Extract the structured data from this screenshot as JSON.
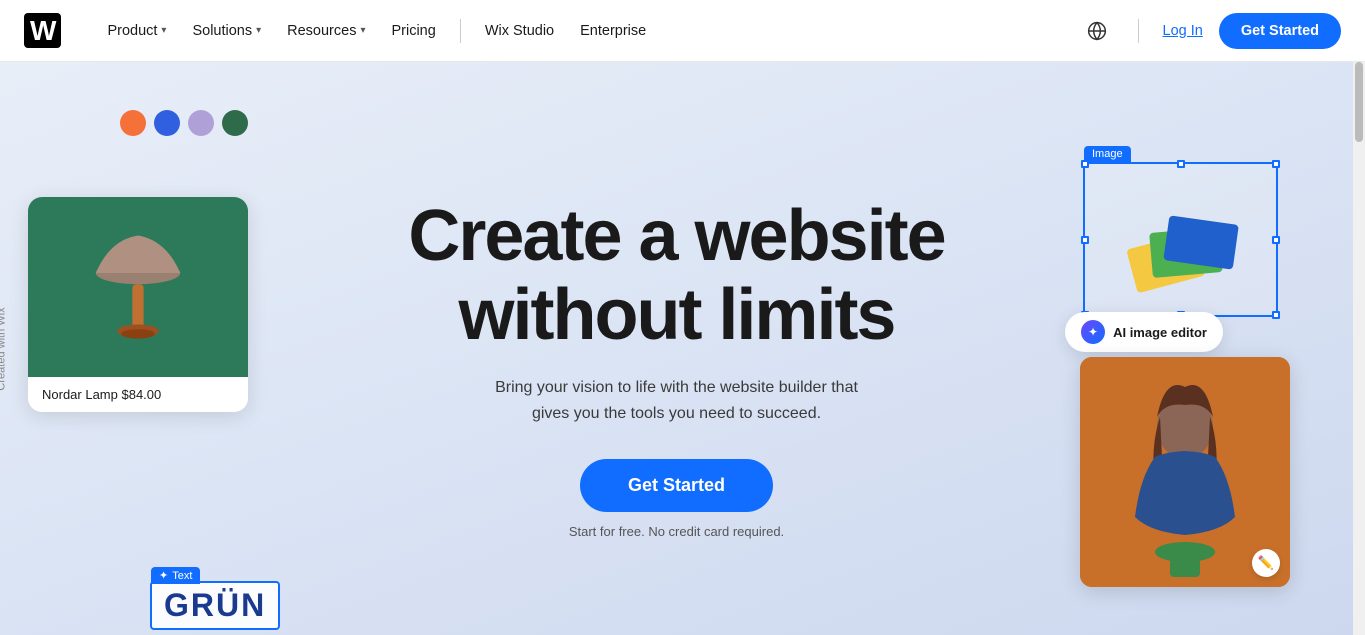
{
  "navbar": {
    "logo": "Wix",
    "nav_items": [
      {
        "label": "Product",
        "has_dropdown": true
      },
      {
        "label": "Solutions",
        "has_dropdown": true
      },
      {
        "label": "Resources",
        "has_dropdown": true
      },
      {
        "label": "Pricing",
        "has_dropdown": false
      },
      {
        "label": "Wix Studio",
        "has_dropdown": false
      },
      {
        "label": "Enterprise",
        "has_dropdown": false
      }
    ],
    "login_label": "Log In",
    "get_started_label": "Get Started"
  },
  "hero": {
    "title_line1": "Create a website",
    "title_line2": "without limits",
    "subtitle": "Bring your vision to life with the website builder that\ngives you the tools you need to succeed.",
    "cta_label": "Get Started",
    "free_text": "Start for free. No credit card required.",
    "product_card_label": "Nordar Lamp $84.00",
    "image_label": "Image",
    "text_label": "Text",
    "text_content": "GRÜN",
    "ai_label": "AI image editor"
  },
  "swatches": {
    "colors": [
      "#f4713a",
      "#3060e0",
      "#b0a0d8",
      "#2d6b4a"
    ]
  },
  "side_label": "Created with Wix"
}
